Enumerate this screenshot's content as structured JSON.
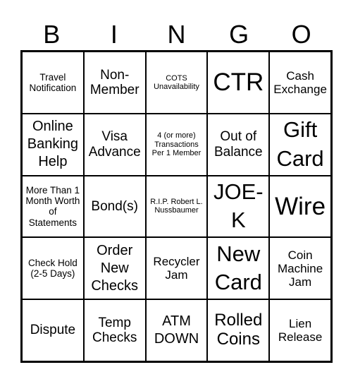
{
  "header": [
    "B",
    "I",
    "N",
    "G",
    "O"
  ],
  "cells": [
    "Travel Notification",
    "Non-Member",
    "COTS Unavailability",
    "CTR",
    "Cash Exchange",
    "Online Banking Help",
    "Visa Advance",
    "4 (or more) Transactions Per 1 Member",
    "Out of Balance",
    "Gift Card",
    "More Than 1 Month Worth of Statements",
    "Bond(s)",
    "R.I.P. Robert L. Nussbaumer",
    "JOE-K",
    "Wire",
    "Check Hold (2-5 Days)",
    "Order New Checks",
    "Recycler Jam",
    "New Card",
    "Coin Machine Jam",
    "Dispute",
    "Temp Checks",
    "ATM DOWN",
    "Rolled Coins",
    "Lien Release"
  ]
}
